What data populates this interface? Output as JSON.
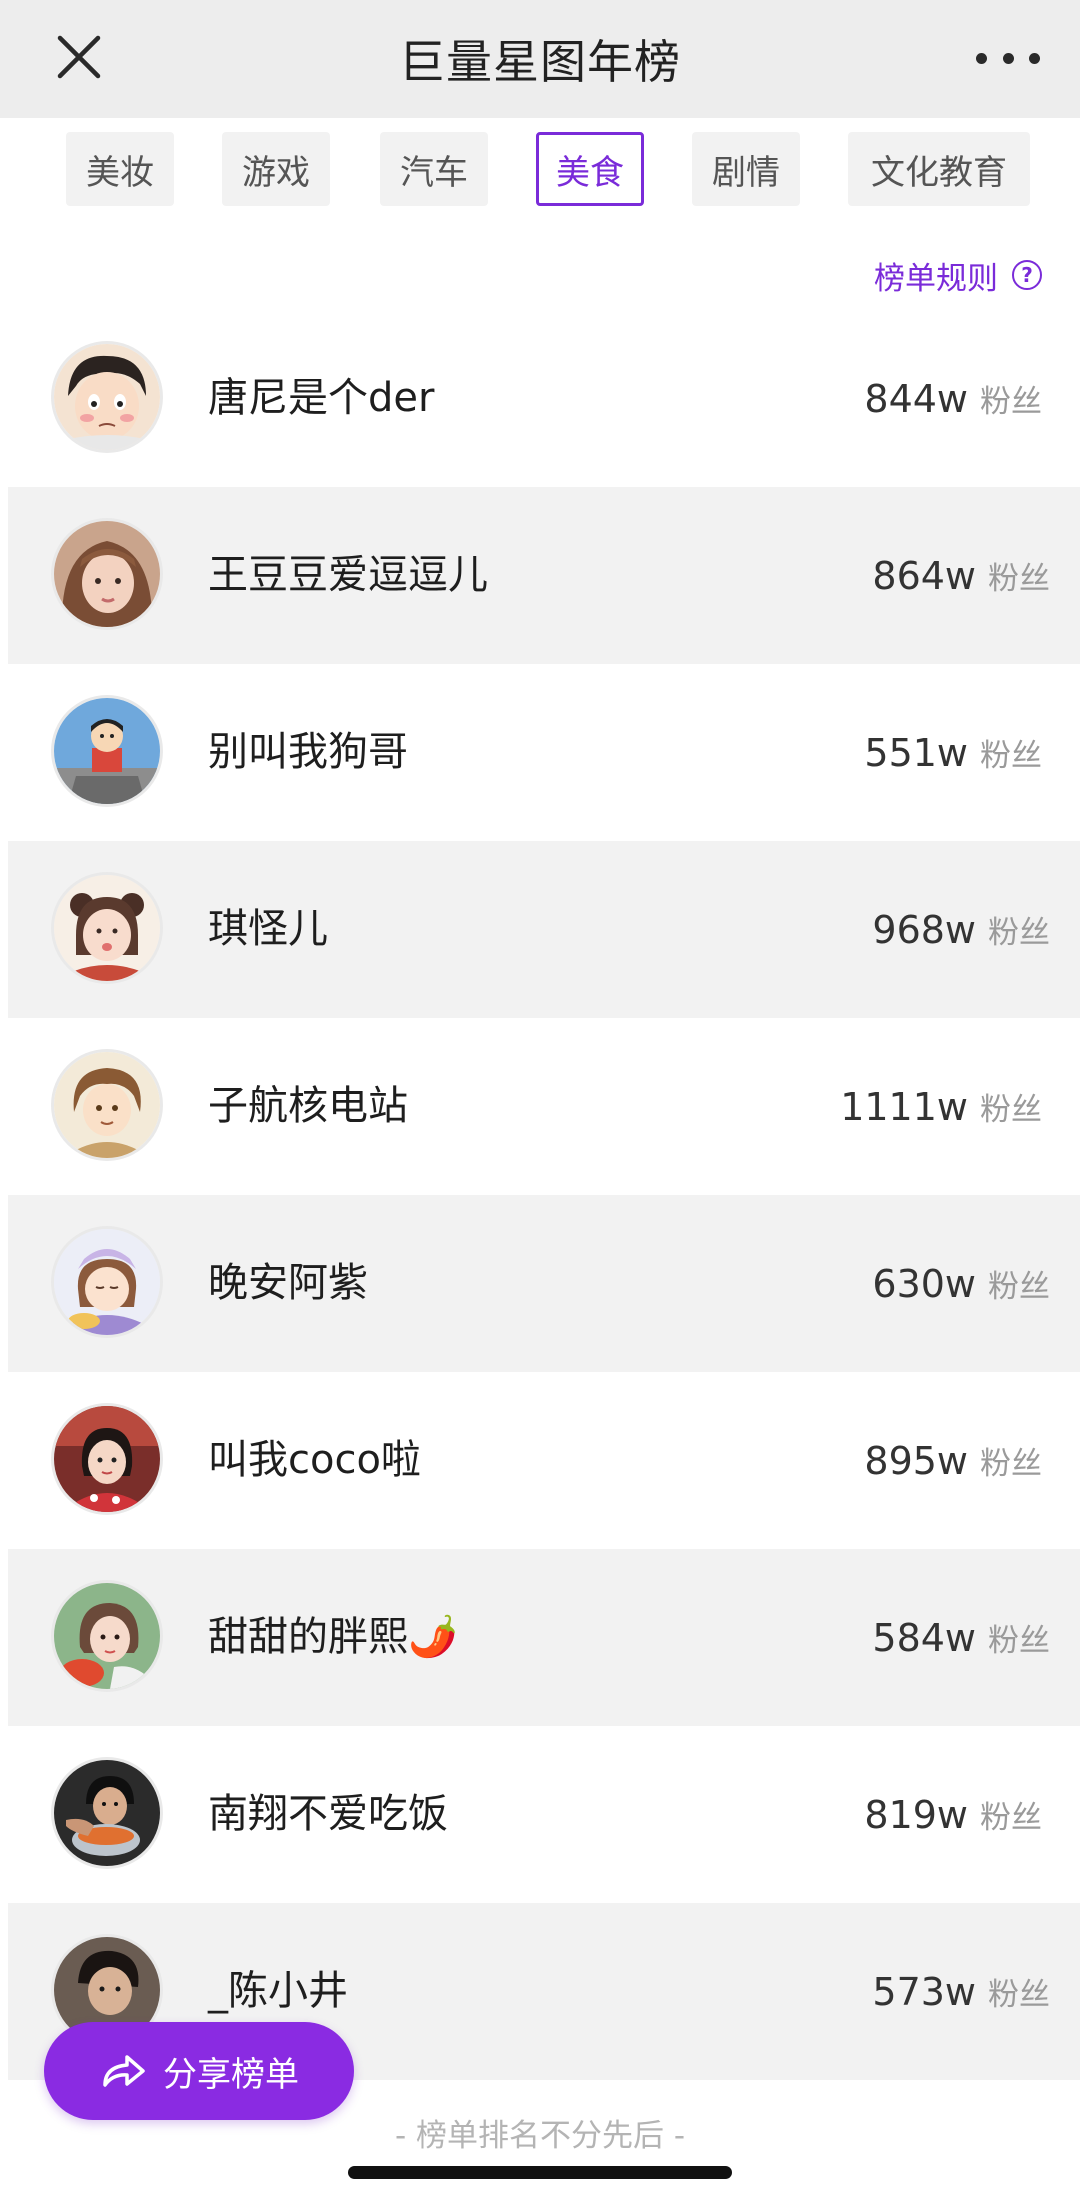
{
  "header": {
    "title": "巨量星图年榜"
  },
  "tabs": [
    {
      "label": "美妆",
      "active": false
    },
    {
      "label": "游戏",
      "active": false
    },
    {
      "label": "汽车",
      "active": false
    },
    {
      "label": "美食",
      "active": true
    },
    {
      "label": "剧情",
      "active": false
    },
    {
      "label": "文化教育",
      "active": false
    }
  ],
  "rules": {
    "label": "榜单规则",
    "icon": "question-circle-icon"
  },
  "list": {
    "unit_label": "粉丝",
    "items": [
      {
        "name": "唐尼是个der",
        "count": "844w",
        "avatar": "avatar-cartoon-boy"
      },
      {
        "name": "王豆豆爱逗逗儿",
        "count": "864w",
        "avatar": "avatar-girl-photo"
      },
      {
        "name": "别叫我狗哥",
        "count": "551w",
        "avatar": "avatar-cartoon-kid"
      },
      {
        "name": "琪怪儿",
        "count": "968w",
        "avatar": "avatar-girl-buns"
      },
      {
        "name": "子航核电站",
        "count": "1111w",
        "avatar": "avatar-anime-boy"
      },
      {
        "name": "晚安阿紫",
        "count": "630w",
        "avatar": "avatar-illustrated-girl"
      },
      {
        "name": "叫我coco啦",
        "count": "895w",
        "avatar": "avatar-girl-red"
      },
      {
        "name": "甜甜的胖熙🌶️",
        "count": "584w",
        "avatar": "avatar-girl-food"
      },
      {
        "name": "南翔不爱吃饭",
        "count": "819w",
        "avatar": "avatar-man-bowl"
      },
      {
        "name": "_陈小井",
        "count": "573w",
        "avatar": "avatar-man-photo"
      }
    ]
  },
  "share": {
    "label": "分享榜单",
    "icon": "share-icon"
  },
  "footer": {
    "note": "- 榜单排名不分先后 -"
  },
  "colors": {
    "accent": "#7a2bd9",
    "share_button": "#8a2be2",
    "header_bg": "#ededed",
    "row_shade": "#f2f2f2"
  }
}
